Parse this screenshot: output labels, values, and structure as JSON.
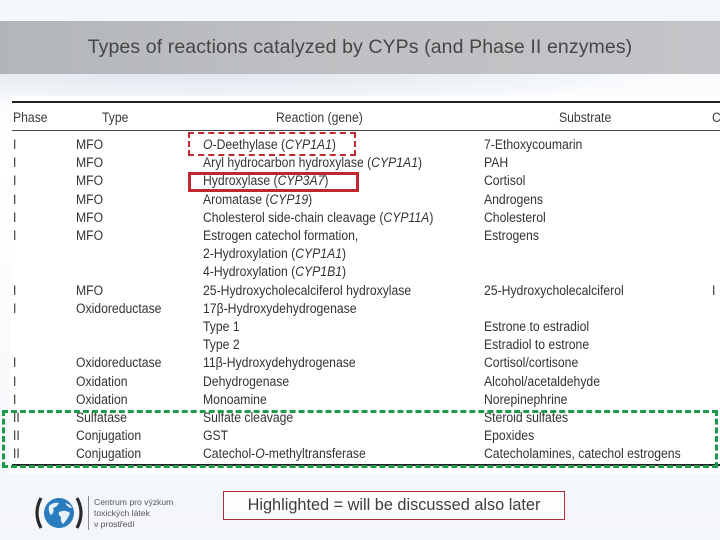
{
  "slide": {
    "title": "Types of reactions catalyzed by CYPs (and Phase II enzymes)",
    "note": "Highlighted = will be discussed also later",
    "logo": {
      "lines": [
        "Centrum pro výzkum",
        "toxických látek",
        "v prostředí"
      ]
    },
    "colors": {
      "title_band": "#b9bbbe",
      "title_text": "#464646",
      "highlight_red": "#c0282d",
      "highlight_green": "#1e9a4a",
      "logo_blue": "#2b7bbf"
    }
  },
  "table": {
    "headers": {
      "phase": "Phase",
      "type": "Type",
      "reaction": "Reaction (gene)",
      "substrate": "Substrate",
      "extra": "C"
    },
    "rows": [
      {
        "phase": "I",
        "type": "MFO",
        "reaction_pre": "",
        "reaction_em_pre": "O",
        "reaction": "-Deethylase (",
        "gene": "CYP1A1",
        "reaction_post": ")",
        "substrate": "7-Ethoxycoumarin",
        "highlight": "red-dashed"
      },
      {
        "phase": "I",
        "type": "MFO",
        "reaction_pre": "",
        "reaction_em_pre": "",
        "reaction": "Aryl hydrocarbon hydroxylase (",
        "gene": "CYP1A1",
        "reaction_post": ")",
        "substrate": "PAH"
      },
      {
        "phase": "I",
        "type": "MFO",
        "reaction_pre": "",
        "reaction_em_pre": "",
        "reaction": "Hydroxylase (",
        "gene": "CYP3A7",
        "reaction_post": ")",
        "substrate": "Cortisol",
        "highlight": "red-solid"
      },
      {
        "phase": "I",
        "type": "MFO",
        "reaction_pre": "",
        "reaction_em_pre": "",
        "reaction": "Aromatase (",
        "gene": "CYP19",
        "reaction_post": ")",
        "substrate": "Androgens"
      },
      {
        "phase": "I",
        "type": "MFO",
        "reaction_pre": "",
        "reaction_em_pre": "",
        "reaction": "Cholesterol side-chain cleavage (",
        "gene": "CYP11A",
        "reaction_post": ")",
        "substrate": "Cholesterol"
      },
      {
        "phase": "I",
        "type": "MFO",
        "reaction_pre": "",
        "reaction_em_pre": "",
        "reaction": "Estrogen catechol formation,",
        "gene": "",
        "reaction_post": "",
        "substrate": "Estrogens"
      },
      {
        "phase": "",
        "type": "",
        "reaction_pre": "",
        "reaction_em_pre": "",
        "reaction": "2-Hydroxylation (",
        "gene": "CYP1A1",
        "reaction_post": ")",
        "substrate": ""
      },
      {
        "phase": "",
        "type": "",
        "reaction_pre": "",
        "reaction_em_pre": "",
        "reaction": "4-Hydroxylation (",
        "gene": "CYP1B1",
        "reaction_post": ")",
        "substrate": ""
      },
      {
        "phase": "I",
        "type": "MFO",
        "reaction_pre": "",
        "reaction_em_pre": "",
        "reaction": "25-Hydroxycholecalciferol hydroxylase",
        "gene": "",
        "reaction_post": "",
        "substrate": "25-Hydroxycholecalciferol"
      },
      {
        "phase": "I",
        "type": "Oxidoreductase",
        "reaction_pre": "",
        "reaction_em_pre": "",
        "reaction": "17β-Hydroxydehydrogenase",
        "gene": "",
        "reaction_post": "",
        "substrate": ""
      },
      {
        "phase": "",
        "type": "",
        "reaction_pre": "",
        "reaction_em_pre": "",
        "reaction": "Type 1",
        "gene": "",
        "reaction_post": "",
        "substrate": "Estrone to estradiol"
      },
      {
        "phase": "",
        "type": "",
        "reaction_pre": "",
        "reaction_em_pre": "",
        "reaction": "Type 2",
        "gene": "",
        "reaction_post": "",
        "substrate": "Estradiol to estrone"
      },
      {
        "phase": "I",
        "type": "Oxidoreductase",
        "reaction_pre": "",
        "reaction_em_pre": "",
        "reaction": "11β-Hydroxydehydrogenase",
        "gene": "",
        "reaction_post": "",
        "substrate": "Cortisol/cortisone"
      },
      {
        "phase": "I",
        "type": "Oxidation",
        "reaction_pre": "",
        "reaction_em_pre": "",
        "reaction": "Dehydrogenase",
        "gene": "",
        "reaction_post": "",
        "substrate": "Alcohol/acetaldehyde"
      },
      {
        "phase": "I",
        "type": "Oxidation",
        "reaction_pre": "",
        "reaction_em_pre": "",
        "reaction": "Monoamine",
        "gene": "",
        "reaction_post": "",
        "substrate": "Norepinephrine"
      },
      {
        "phase": "II",
        "type": "Sulfatase",
        "reaction_pre": "",
        "reaction_em_pre": "",
        "reaction": "Sulfate cleavage",
        "gene": "",
        "reaction_post": "",
        "substrate": "Steroid sulfates",
        "highlight": "green"
      },
      {
        "phase": "II",
        "type": "Conjugation",
        "reaction_pre": "",
        "reaction_em_pre": "",
        "reaction": "GST",
        "gene": "",
        "reaction_post": "",
        "substrate": "Epoxides",
        "highlight": "green"
      },
      {
        "phase": "II",
        "type": "Conjugation",
        "reaction_pre": "Catechol-",
        "reaction_em_pre": "O",
        "reaction": "-methyltransferase",
        "gene": "",
        "reaction_post": "",
        "substrate": "Catecholamines, catechol estrogens",
        "highlight": "green"
      }
    ],
    "extra_column_marks": [
      {
        "row": 8,
        "text": "I"
      }
    ]
  }
}
